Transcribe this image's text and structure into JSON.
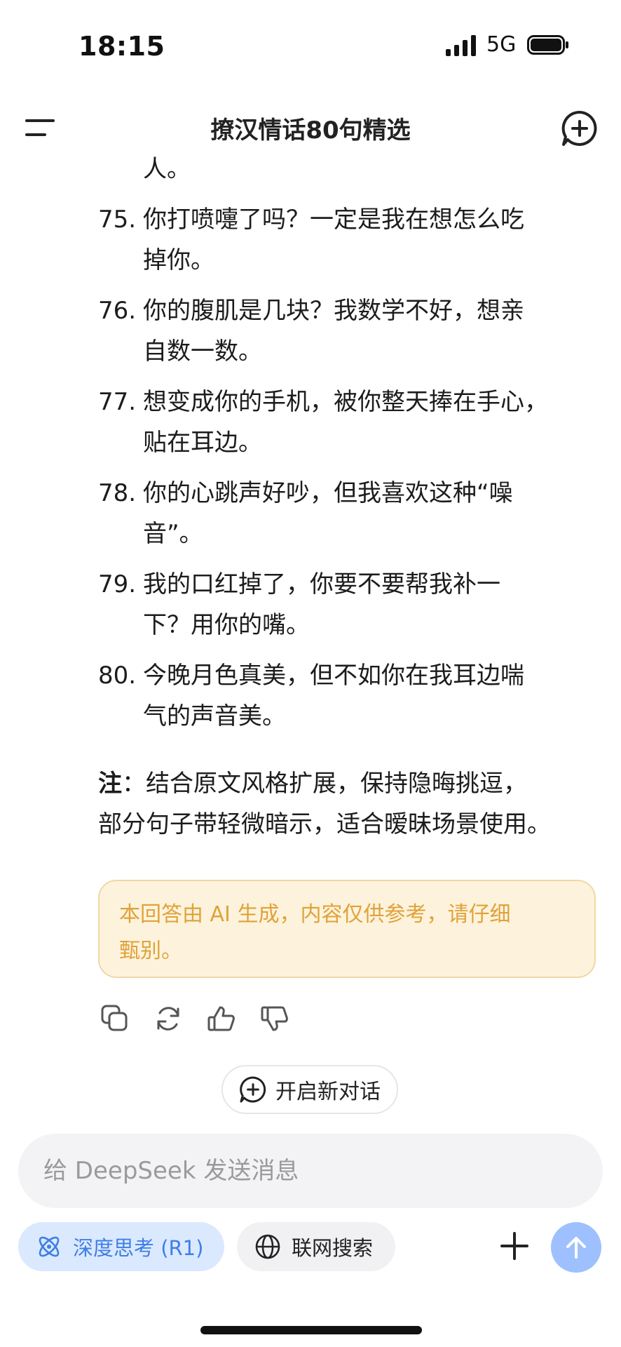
{
  "status": {
    "time": "18:15",
    "network": "5G"
  },
  "header": {
    "title": "撩汉情话80句精选"
  },
  "content": {
    "lead_text": "人。",
    "items": [
      {
        "num": "75.",
        "lines": [
          "你打喷嚏了吗？一定是我在想怎么吃",
          "掉你。"
        ]
      },
      {
        "num": "76.",
        "lines": [
          "你的腹肌是几块？我数学不好，想亲",
          "自数一数。"
        ]
      },
      {
        "num": "77.",
        "lines": [
          "想变成你的手机，被你整天捧在手心，",
          "贴在耳边。"
        ]
      },
      {
        "num": "78.",
        "lines": [
          "你的心跳声好吵，但我喜欢这种“噪",
          "音”。"
        ]
      },
      {
        "num": "79.",
        "lines": [
          "我的口红掉了，你要不要帮我补一",
          "下？用你的嘴。"
        ]
      },
      {
        "num": "80.",
        "lines": [
          "今晚月色真美，但不如你在我耳边喘",
          "气的声音美。"
        ]
      }
    ],
    "note_label": "注",
    "note_line1": "：结合原文风格扩展，保持隐晦挑逗，",
    "note_line2": "部分句子带轻微暗示，适合暧昧场景使用。"
  },
  "disclaimer": {
    "line1": "本回答由 AI 生成，内容仅供参考，请仔细",
    "line2": "甄别。"
  },
  "new_dialog": {
    "label": "开启新对话"
  },
  "composer": {
    "placeholder": "给 DeepSeek 发送消息",
    "deep_think_label": "深度思考 (R1)",
    "web_search_label": "联网搜索"
  },
  "colors": {
    "accent": "#3f7ee6",
    "send": "#9ec0ff",
    "disclaimer_text": "#e0a23a",
    "disclaimer_bg": "#fdf3dc"
  }
}
